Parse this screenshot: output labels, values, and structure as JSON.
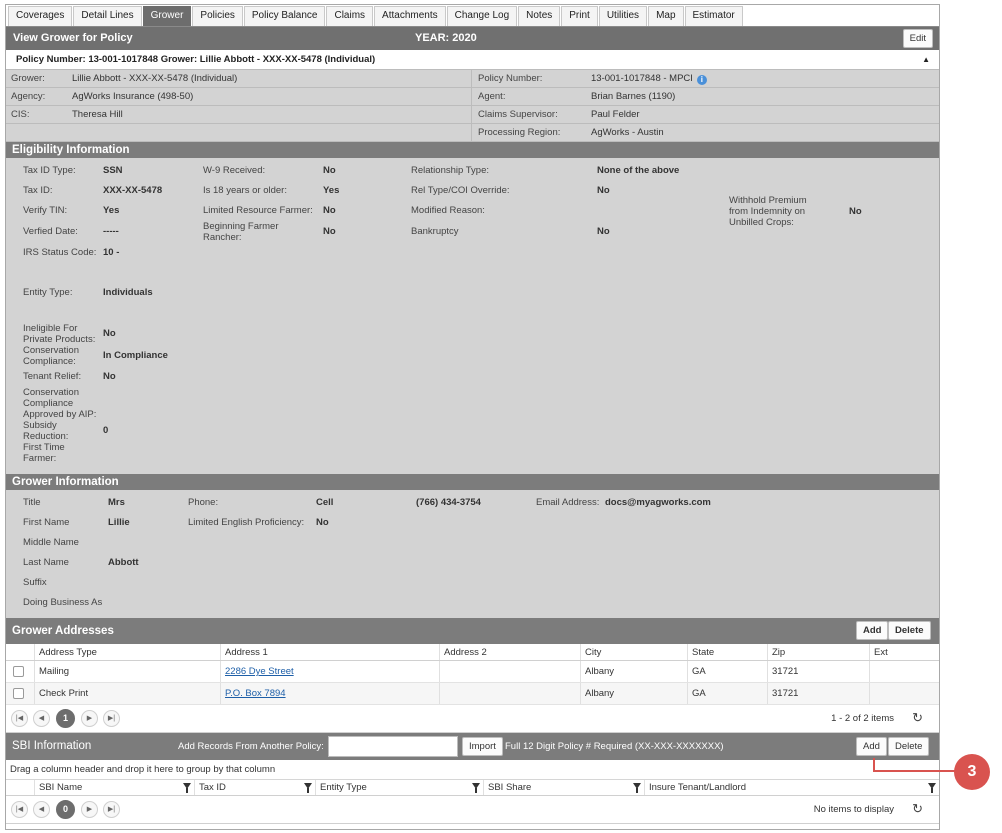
{
  "tabs": [
    "Coverages",
    "Detail Lines",
    "Grower",
    "Policies",
    "Policy Balance",
    "Claims",
    "Attachments",
    "Change Log",
    "Notes",
    "Print",
    "Utilities",
    "Map",
    "Estimator"
  ],
  "titlebar": {
    "title": "View Grower for Policy",
    "year": "YEAR: 2020",
    "edit": "Edit"
  },
  "policy_header": "Policy Number: 13-001-1017848 Grower: Lillie Abbott - XXX-XX-5478 (Individual)",
  "info": {
    "grower_label": "Grower:",
    "grower": "Lillie Abbott - XXX-XX-5478 (Individual)",
    "agency_label": "Agency:",
    "agency": "AgWorks Insurance (498-50)",
    "cis_label": "CIS:",
    "cis": "Theresa Hill",
    "policy_number_label": "Policy Number:",
    "policy_number": "13-001-1017848 - MPCI",
    "agent_label": "Agent:",
    "agent": "Brian Barnes (1190)",
    "claims_supervisor_label": "Claims Supervisor:",
    "claims_supervisor": "Paul Felder",
    "processing_region_label": "Processing Region:",
    "processing_region": "AgWorks - Austin"
  },
  "eligibility": {
    "title": "Eligibility Information",
    "tax_id_type_label": "Tax ID Type:",
    "tax_id_type": "SSN",
    "tax_id_label": "Tax ID:",
    "tax_id": "XXX-XX-5478",
    "verify_tin_label": "Verify TIN:",
    "verify_tin": "Yes",
    "verified_date_label": "Verfied Date:",
    "verified_date": "-----",
    "irs_status_label": "IRS Status Code:",
    "irs_status": "10 -",
    "entity_type_label": "Entity Type:",
    "entity_type": "Individuals",
    "ineligible_label_1": "Ineligible For",
    "ineligible_label_2": "Private Products:",
    "ineligible": "No",
    "conservation_label_1": "Conservation",
    "conservation_label_2": "Compliance:",
    "conservation": "In Compliance",
    "tenant_relief_label": "Tenant Relief:",
    "tenant_relief": "No",
    "cons_aip_1": "Conservation",
    "cons_aip_2": "Compliance",
    "cons_aip_3": "Approved by AIP:",
    "subsidy_1": "Subsidy",
    "subsidy_2": "Reduction:",
    "subsidy": "0",
    "first_time_1": "First Time",
    "first_time_2": "Farmer:",
    "w9_label": "W-9 Received:",
    "w9": "No",
    "age18_label": "Is 18 years or older:",
    "age18": "Yes",
    "limited_label": "Limited Resource Farmer:",
    "limited": "No",
    "beginning_label_1": "Beginning Farmer",
    "beginning_label_2": "Rancher:",
    "beginning": "No",
    "relationship_label": "Relationship Type:",
    "relationship": "None of the above",
    "rel_override_label": "Rel Type/COI Override:",
    "rel_override": "No",
    "modified_label": "Modified Reason:",
    "bankruptcy_label": "Bankruptcy",
    "bankruptcy": "No",
    "withhold_1": "Withhold Premium",
    "withhold_2": "from Indemnity on",
    "withhold_3": "Unbilled Crops:",
    "withhold": "No"
  },
  "grower_info": {
    "title": "Grower Information",
    "title_label": "Title",
    "title_value": "Mrs",
    "first_name_label": "First Name",
    "first_name": "Lillie",
    "middle_name_label": "Middle Name",
    "last_name_label": "Last Name",
    "last_name": "Abbott",
    "suffix_label": "Suffix",
    "dba_label": "Doing Business As",
    "phone_label": "Phone:",
    "phone_type": "Cell",
    "phone": "(766) 434-3754",
    "lep_label": "Limited English Proficiency:",
    "lep": "No",
    "email_label": "Email Address:",
    "email": "docs@myagworks.com"
  },
  "addresses": {
    "title": "Grower Addresses",
    "add": "Add",
    "delete": "Delete",
    "columns": [
      "Address Type",
      "Address 1",
      "Address 2",
      "City",
      "State",
      "Zip",
      "Ext"
    ],
    "rows": [
      {
        "type": "Mailing",
        "address1": "2286 Dye Street",
        "address2": "",
        "city": "Albany",
        "state": "GA",
        "zip": "31721",
        "ext": ""
      },
      {
        "type": "Check Print",
        "address1": "P.O. Box 7894",
        "address2": "",
        "city": "Albany",
        "state": "GA",
        "zip": "31721",
        "ext": ""
      }
    ],
    "page": "1",
    "count": "1 - 2 of 2 items"
  },
  "sbi": {
    "title": "SBI Information",
    "add_records_label": "Add Records From Another Policy:",
    "policy_input_value": "",
    "import": "Import",
    "requirement": "Full 12 Digit Policy # Required (XX-XXX-XXXXXXX)",
    "add": "Add",
    "delete": "Delete",
    "group_hint": "Drag a column header and drop it here to group by that column",
    "columns": [
      "SBI Name",
      "Tax ID",
      "Entity Type",
      "SBI Share",
      "Insure Tenant/Landlord"
    ],
    "page": "0",
    "count": "No items to display"
  },
  "callout": "3",
  "colors": {
    "header_gray": "#707070",
    "section_gray": "#7c7c7c",
    "panel_gray": "#d3d3d3",
    "callout_red": "#d9534f",
    "link_blue": "#1e5fa8"
  }
}
